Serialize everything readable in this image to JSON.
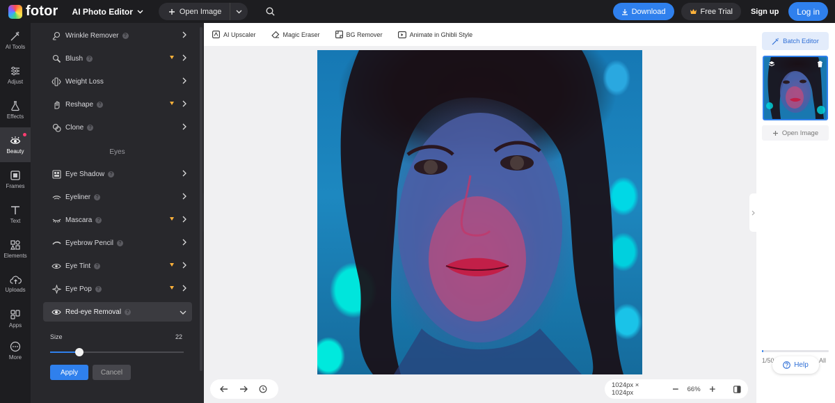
{
  "app": {
    "logo": "fotor",
    "editor_mode": "AI Photo Editor"
  },
  "topbar": {
    "open_image": "Open Image",
    "download": "Download",
    "free_trial": "Free Trial",
    "signup": "Sign up",
    "login": "Log in"
  },
  "rail": [
    {
      "label": "AI Tools",
      "icon": "ai-tools-icon"
    },
    {
      "label": "Adjust",
      "icon": "adjust-icon"
    },
    {
      "label": "Effects",
      "icon": "effects-icon"
    },
    {
      "label": "Beauty",
      "icon": "beauty-icon",
      "active": true
    },
    {
      "label": "Frames",
      "icon": "frames-icon"
    },
    {
      "label": "Text",
      "icon": "text-icon"
    },
    {
      "label": "Elements",
      "icon": "elements-icon"
    },
    {
      "label": "Uploads",
      "icon": "uploads-icon"
    },
    {
      "label": "Apps",
      "icon": "apps-icon"
    },
    {
      "label": "More",
      "icon": "more-icon"
    }
  ],
  "panel": {
    "items_top": [
      {
        "label": "Wrinkle Remover",
        "premium": false
      },
      {
        "label": "Blush",
        "premium": true
      },
      {
        "label": "Weight Loss",
        "premium": false
      },
      {
        "label": "Reshape",
        "premium": true
      },
      {
        "label": "Clone",
        "premium": false
      }
    ],
    "section_eyes": "Eyes",
    "items_eyes": [
      {
        "label": "Eye Shadow",
        "premium": false
      },
      {
        "label": "Eyeliner",
        "premium": false
      },
      {
        "label": "Mascara",
        "premium": true
      },
      {
        "label": "Eyebrow Pencil",
        "premium": false
      },
      {
        "label": "Eye Tint",
        "premium": true
      },
      {
        "label": "Eye Pop",
        "premium": true
      }
    ],
    "expanded": {
      "label": "Red-eye Removal",
      "size_label": "Size",
      "size_value": "22",
      "slider_fraction": 0.22
    },
    "apply": "Apply",
    "cancel": "Cancel"
  },
  "tools": [
    {
      "label": "AI Upscaler"
    },
    {
      "label": "Magic Eraser"
    },
    {
      "label": "BG Remover"
    },
    {
      "label": "Animate in Ghibli Style"
    }
  ],
  "canvas": {
    "dimensions": "1024px × 1024px",
    "zoom": "66%"
  },
  "right_panel": {
    "batch_editor": "Batch Editor",
    "open_image": "Open Image",
    "count": "1/50",
    "view_all": "All",
    "progress_fraction": 0.02
  },
  "help": "Help",
  "colors": {
    "accent": "#2f80ed",
    "dark_bg": "#1d1d20",
    "panel_bg": "#28282c",
    "premium": "#ffb23a"
  }
}
